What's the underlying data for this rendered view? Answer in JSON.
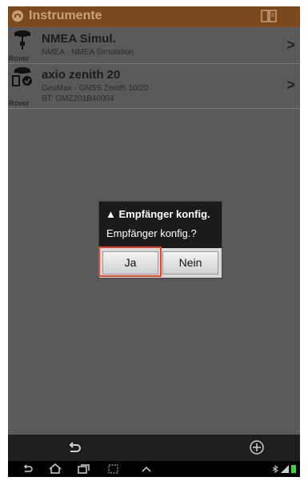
{
  "header": {
    "title": "Instrumente",
    "app_icon": "app-logo-icon",
    "device_icon": "device-panel-icon"
  },
  "instruments": [
    {
      "name": "NMEA Simul.",
      "description": "NMEA - NMEA Simulation",
      "role": "Rover",
      "icon": "antenna-icon"
    },
    {
      "name": "axio zenith 20",
      "description": "GeoMax - GNSS Zenith 10/20",
      "detail": "BT: GMZ201B40004",
      "role": "Rover",
      "icon": "antenna-connected-icon"
    }
  ],
  "dialog": {
    "title": "Empfänger konfig.",
    "message": "Empfänger konfig.?",
    "confirm_label": "Ja",
    "cancel_label": "Nein",
    "title_icon": "warning-icon"
  },
  "actionbar": {
    "back_icon": "back-arrow-icon",
    "add_icon": "add-circle-icon"
  },
  "system_nav": {
    "icons": [
      "back-icon",
      "home-icon",
      "recent-apps-icon",
      "screenshot-icon",
      "chevron-up-icon"
    ],
    "status_icons": [
      "bluetooth-icon",
      "signal-icon",
      "battery-icon"
    ]
  },
  "colors": {
    "title_bar": "#7a4a1e",
    "title_text": "#c8a07a",
    "background": "#5a5a5a",
    "highlight": "#e2472f"
  }
}
